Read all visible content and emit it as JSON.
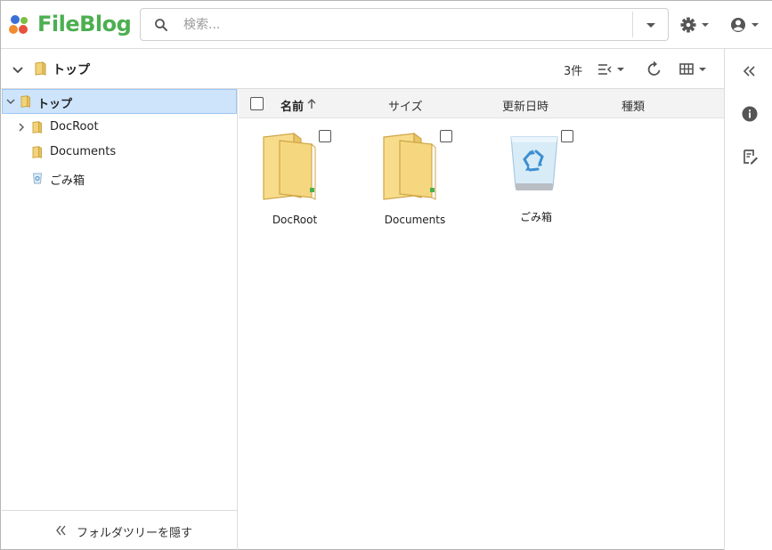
{
  "app": {
    "logo_text": "FileBlog",
    "brand_color": "#4caf50"
  },
  "search": {
    "placeholder": "検索...",
    "value": ""
  },
  "header": {
    "settings_icon": "gear-icon",
    "account_icon": "account-circle-icon"
  },
  "toolbar": {
    "current_folder": "トップ",
    "item_count": "3件"
  },
  "tree": {
    "items": [
      {
        "label": "トップ",
        "icon": "folder-icon",
        "selected": true,
        "expanded": true
      },
      {
        "label": "DocRoot",
        "icon": "folder-icon",
        "selected": false,
        "expandable": true
      },
      {
        "label": "Documents",
        "icon": "folder-icon",
        "selected": false
      },
      {
        "label": "ごみ箱",
        "icon": "recycle-bin-icon",
        "selected": false
      }
    ],
    "hide_label": "フォルダツリーを隠す"
  },
  "columns": {
    "name": "名前",
    "size": "サイズ",
    "modified": "更新日時",
    "type": "種類"
  },
  "files": [
    {
      "name": "DocRoot",
      "icon": "folder-icon"
    },
    {
      "name": "Documents",
      "icon": "folder-icon"
    },
    {
      "name": "ごみ箱",
      "icon": "recycle-bin-icon"
    }
  ],
  "colors": {
    "selected_bg": "#cde4fb",
    "folder_yellow": "#f3d37a"
  }
}
